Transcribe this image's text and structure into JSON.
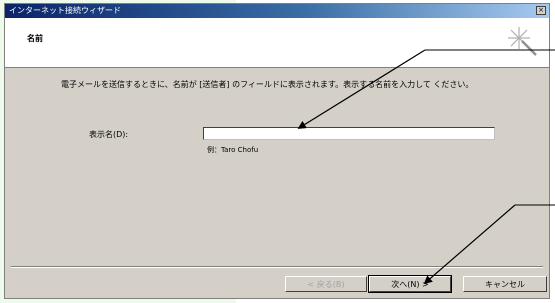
{
  "window": {
    "title": "インターネット接続ウィザード",
    "close_label": "×"
  },
  "header": {
    "heading": "名前"
  },
  "body": {
    "description": "電子メールを送信するときに、名前が [送信者] のフィールドに表示されます。表示する名前を入力して ください。",
    "field_label": "表示名(D):",
    "input_value": "",
    "example": "例：Taro Chofu"
  },
  "buttons": {
    "back": "< 戻る(B)",
    "next": "次へ(N) >",
    "cancel": "キャンセル"
  },
  "colors": {
    "titlebar_start": "#0a246a",
    "dialog_face": "#d4d0c8",
    "page_left_bg": "#eefbea"
  }
}
